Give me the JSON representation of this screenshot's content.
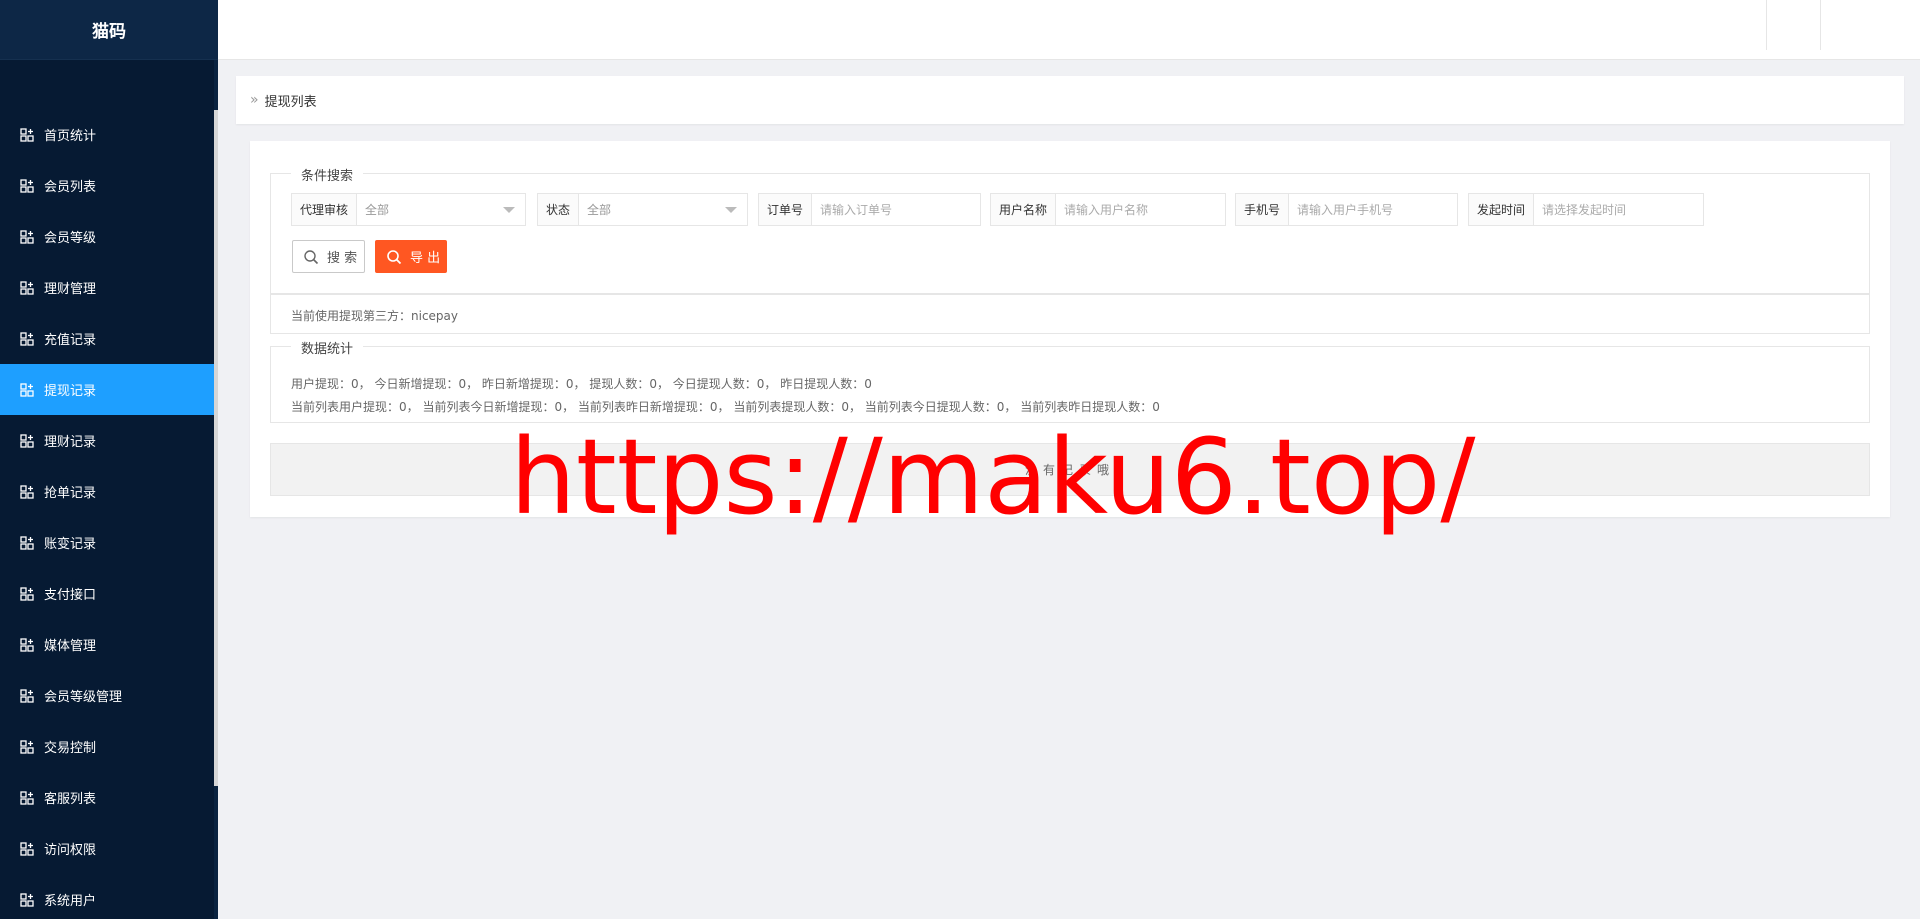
{
  "app": {
    "title": "猫码"
  },
  "sidebar": {
    "items": [
      {
        "label": "首页统计"
      },
      {
        "label": "会员列表"
      },
      {
        "label": "会员等级"
      },
      {
        "label": "理财管理"
      },
      {
        "label": "充值记录"
      },
      {
        "label": "提现记录",
        "active": true
      },
      {
        "label": "理财记录"
      },
      {
        "label": "抢单记录"
      },
      {
        "label": "账变记录"
      },
      {
        "label": "支付接口"
      },
      {
        "label": "媒体管理"
      },
      {
        "label": "会员等级管理"
      },
      {
        "label": "交易控制"
      },
      {
        "label": "客服列表"
      },
      {
        "label": "访问权限"
      },
      {
        "label": "系统用户"
      }
    ]
  },
  "breadcrumb": {
    "title": "提现列表"
  },
  "search": {
    "legend": "条件搜索",
    "agent_review": {
      "label": "代理审核",
      "value": "全部"
    },
    "status": {
      "label": "状态",
      "value": "全部"
    },
    "order_no": {
      "label": "订单号",
      "placeholder": "请输入订单号"
    },
    "username": {
      "label": "用户名称",
      "placeholder": "请输入用户名称"
    },
    "phone": {
      "label": "手机号",
      "placeholder": "请输入用户手机号"
    },
    "time": {
      "label": "发起时间",
      "placeholder": "请选择发起时间"
    },
    "search_button": "搜 索",
    "export_button": "导 出"
  },
  "third_party": "当前使用提现第三方：nicepay",
  "stats": {
    "legend": "数据统计",
    "line1": "用户提现：0， 今日新增提现：0， 昨日新增提现：0， 提现人数：0， 今日提现人数：0， 昨日提现人数：0",
    "line2": "当前列表用户提现：0， 当前列表今日新增提现：0， 当前列表昨日新增提现：0， 当前列表提现人数：0， 当前列表今日提现人数：0， 当前列表昨日提现人数：0"
  },
  "empty_text": "没有记录哦",
  "watermark": "https://maku6.top/",
  "colors": {
    "sidebar_bg": "#061a33",
    "active": "#1e9fff",
    "export": "#ff5722",
    "watermark": "#ff0000"
  }
}
